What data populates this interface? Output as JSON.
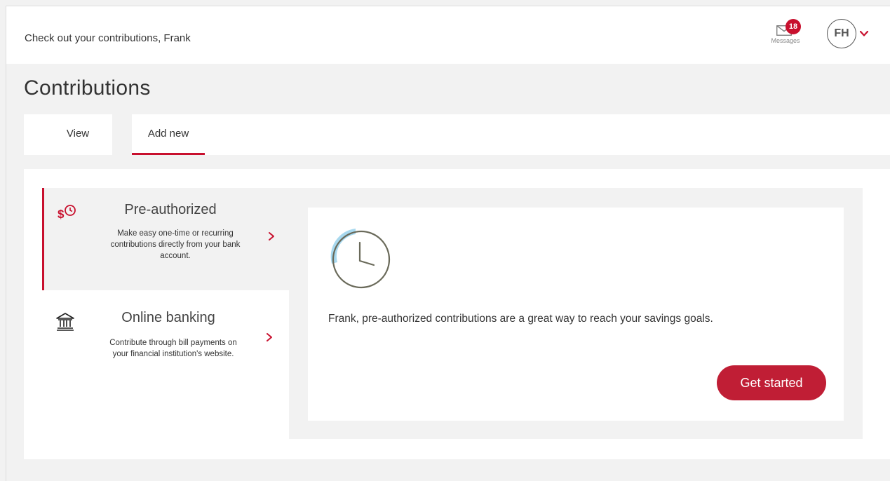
{
  "header": {
    "greeting": "Check out your contributions, Frank",
    "messages_count": "18",
    "messages_label": "Messages",
    "avatar_initials": "FH"
  },
  "page": {
    "title": "Contributions"
  },
  "tabs": [
    {
      "label": "View",
      "active": false
    },
    {
      "label": "Add new",
      "active": true
    }
  ],
  "options": [
    {
      "icon": "dollar-clock-icon",
      "title": "Pre-authorized",
      "description": "Make easy one-time or recurring contributions directly from your bank account.",
      "selected": true
    },
    {
      "icon": "bank-icon",
      "title": "Online banking",
      "description": "Contribute through bill payments on your financial institution's website.",
      "selected": false
    }
  ],
  "detail": {
    "icon": "clock-icon",
    "text": "Frank, pre-authorized contributions are a great way to reach your savings goals.",
    "cta_label": "Get started"
  },
  "colors": {
    "accent": "#c8102e",
    "background": "#f2f2f2"
  }
}
